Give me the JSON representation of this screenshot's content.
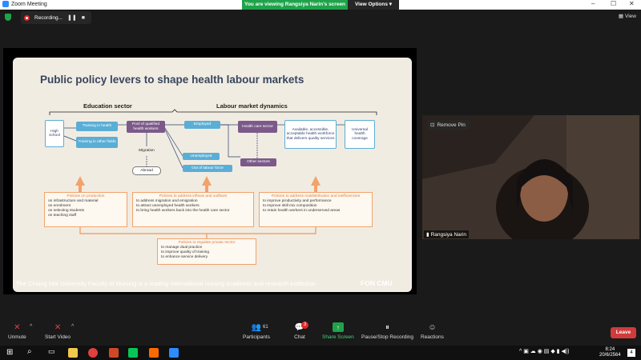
{
  "window": {
    "title": "Zoom Meeting",
    "controls": [
      "–",
      "☐",
      "✕"
    ]
  },
  "banner": {
    "message": "You are viewing Rangsiya Narin's screen",
    "view_options": "View Options ▾"
  },
  "recording": {
    "label": "Recording...",
    "pause": "❚❚",
    "stop": "■"
  },
  "view": {
    "label": "View"
  },
  "slide": {
    "title": "Public policy levers to shape health labour markets",
    "headers": {
      "education": "Education sector",
      "labour": "Labour market dynamics"
    },
    "boxes": {
      "high_school": "High school",
      "training_health": "Training in health",
      "training_other": "Training in other fields",
      "pool": "Pool of qualified health workers",
      "migration": "Migration",
      "abroad": "Abroad",
      "employed": "Employed",
      "unemployed": "Unemployed",
      "out_of_labour": "Out of labour force",
      "health_care_sector": "Health care sector",
      "other_sectors": "Other sectors",
      "available": "Available, accessible, acceptable health workforce that delivers quality services",
      "universal": "Universal health coverage"
    },
    "policies": [
      {
        "heading": "Policies on production",
        "items": [
          "on infrastructure and material",
          "on enrolment",
          "on selecting students",
          "on teaching staff"
        ]
      },
      {
        "heading": "Policies to address inflows and outflows",
        "items": [
          "to address migration and emigration",
          "to attract unemployed health workers",
          "to bring health workers back into the health care sector"
        ]
      },
      {
        "heading": "Policies to address maldistribution and inefficiencies",
        "items": [
          "to improve productivity and performance",
          "to improve skill mix composition",
          "to retain health workers in underserved areas"
        ]
      },
      {
        "heading": "Policies to regulate private sector",
        "items": [
          "to manage dual practice",
          "to improve quality of training",
          "to enhance service delivery"
        ]
      }
    ],
    "footer": "The Chiang Mai University Faculty of Nursing is a leading international nursing academic and research institution",
    "logo": "FON CMU"
  },
  "video": {
    "remove_pin": "Remove Pin",
    "name": "Rangsiya Narin"
  },
  "toolbar": {
    "unmute": "Unmute",
    "start_video": "Start Video",
    "participants": "Participants",
    "participants_count": "61",
    "chat": "Chat",
    "chat_badge": "3",
    "share": "Share Screen",
    "pause_stop": "Pause/Stop Recording",
    "reactions": "Reactions",
    "leave": "Leave"
  },
  "taskbar": {
    "time": "8:24",
    "date": "20/6/2564",
    "notif": "4"
  },
  "colors": {
    "share_green": "#1fa34a",
    "leave_red": "#d13b3b",
    "slide_blue": "#5aaed6",
    "slide_purple": "#7b5a8a",
    "slide_orange": "#f2a26c"
  }
}
